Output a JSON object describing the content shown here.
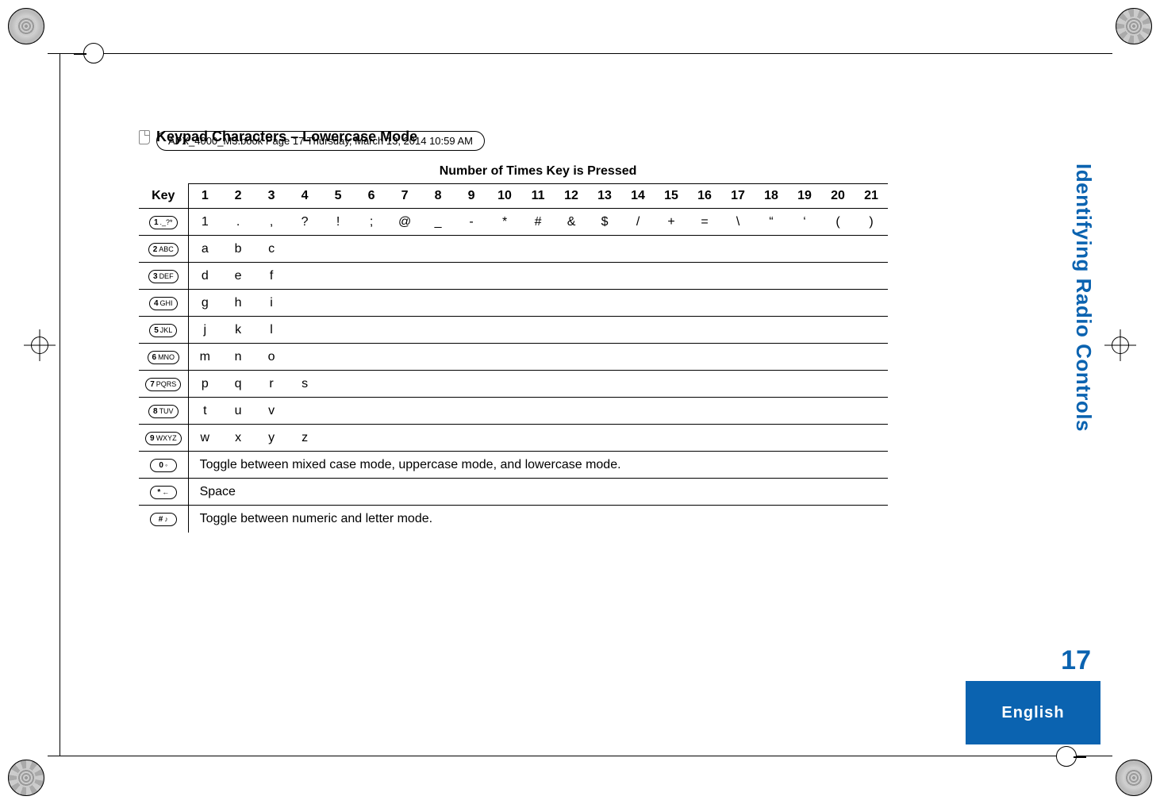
{
  "running_header": "APX_4000_M3.book  Page 17  Thursday, March 13, 2014  10:59 AM",
  "section_title": "Keypad Characters – Lowercase Mode",
  "table": {
    "spanner": "Number of Times Key is Pressed",
    "key_header": "Key",
    "count_headers": [
      "1",
      "2",
      "3",
      "4",
      "5",
      "6",
      "7",
      "8",
      "9",
      "10",
      "11",
      "12",
      "13",
      "14",
      "15",
      "16",
      "17",
      "18",
      "19",
      "20",
      "21"
    ],
    "rows": [
      {
        "key_main": "1",
        "key_sub": "._?*",
        "cells": [
          "1",
          ".",
          ",",
          "?",
          "!",
          ";",
          "@",
          "_",
          "-",
          "*",
          "#",
          "&",
          "$",
          "/",
          "+",
          "=",
          "\\",
          "“",
          "‘",
          "(",
          ")"
        ]
      },
      {
        "key_main": "2",
        "key_sub": "ABC",
        "cells": [
          "a",
          "b",
          "c"
        ]
      },
      {
        "key_main": "3",
        "key_sub": "DEF",
        "cells": [
          "d",
          "e",
          "f"
        ]
      },
      {
        "key_main": "4",
        "key_sub": "GHI",
        "cells": [
          "g",
          "h",
          "i"
        ]
      },
      {
        "key_main": "5",
        "key_sub": "JKL",
        "cells": [
          "j",
          "k",
          "l"
        ]
      },
      {
        "key_main": "6",
        "key_sub": "MNO",
        "cells": [
          "m",
          "n",
          "o"
        ]
      },
      {
        "key_main": "7",
        "key_sub": "PQRS",
        "cells": [
          "p",
          "q",
          "r",
          "s"
        ]
      },
      {
        "key_main": "8",
        "key_sub": "TUV",
        "cells": [
          "t",
          "u",
          "v"
        ]
      },
      {
        "key_main": "9",
        "key_sub": "WXYZ",
        "cells": [
          "w",
          "x",
          "y",
          "z"
        ]
      },
      {
        "key_main": "0",
        "key_sub": "◦",
        "full": "Toggle between mixed case mode, uppercase mode, and lowercase mode."
      },
      {
        "key_main": "*",
        "key_sub": "←",
        "full": "Space"
      },
      {
        "key_main": "#",
        "key_sub": "♪",
        "full": "Toggle between numeric and letter mode."
      }
    ]
  },
  "side_tab": "Identifying Radio Controls",
  "page_number": "17",
  "footer": "English"
}
